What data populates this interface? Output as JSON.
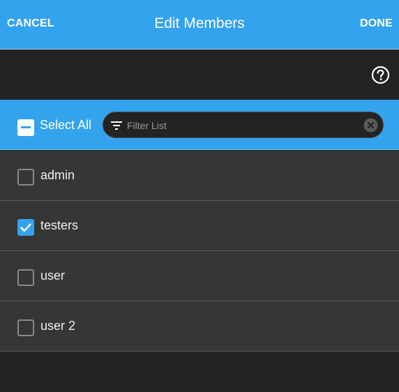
{
  "header": {
    "cancel_label": "CANCEL",
    "title": "Edit Members",
    "done_label": "DONE"
  },
  "toolbar": {
    "help_icon": "help-circle-icon"
  },
  "filterbar": {
    "select_all_label": "Select All",
    "select_all_state": "indeterminate",
    "filter_placeholder": "Filter List",
    "filter_value": "",
    "filter_icon": "filter-icon",
    "clear_icon": "clear-icon"
  },
  "members": [
    {
      "label": "admin",
      "checked": false
    },
    {
      "label": "testers",
      "checked": true
    },
    {
      "label": "user",
      "checked": false
    },
    {
      "label": "user 2",
      "checked": false
    }
  ],
  "colors": {
    "accent": "#34a3ee",
    "background": "#232323",
    "row_background": "#363636",
    "divider": "#5e5e5e"
  }
}
